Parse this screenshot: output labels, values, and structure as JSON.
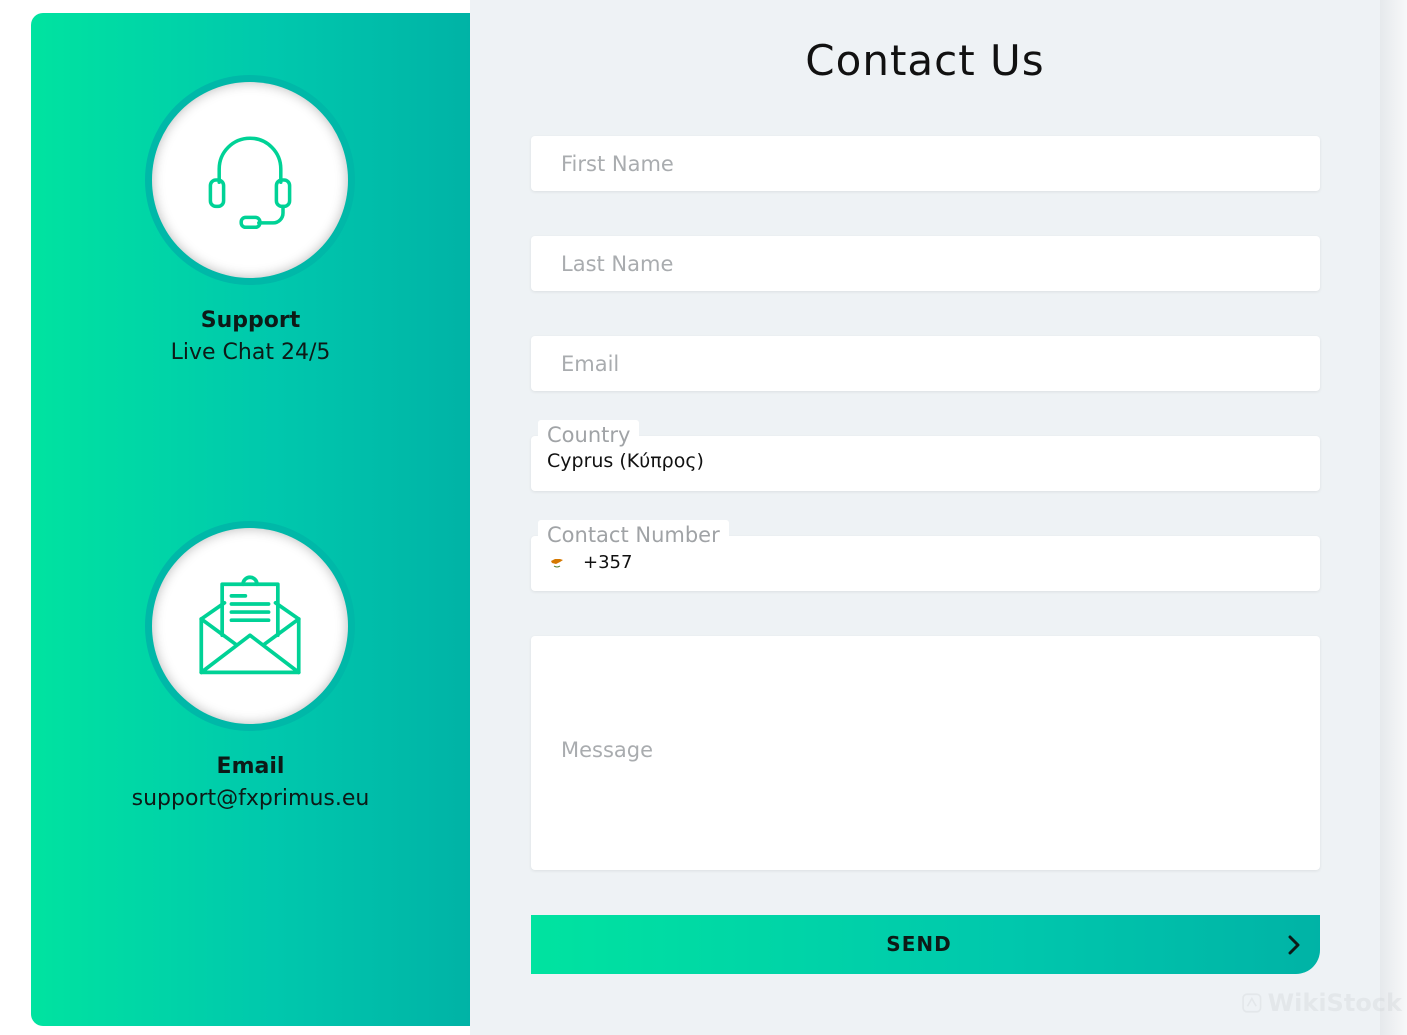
{
  "contact_info": {
    "support": {
      "title": "Support",
      "value": "Live Chat 24/5",
      "icon": "headset-icon"
    },
    "email": {
      "title": "Email",
      "value": "support@fxprimus.eu",
      "icon": "open-envelope-icon"
    }
  },
  "form": {
    "title": "Contact Us",
    "first_name": {
      "placeholder": "First Name",
      "value": ""
    },
    "last_name": {
      "placeholder": "Last Name",
      "value": ""
    },
    "email": {
      "placeholder": "Email",
      "value": ""
    },
    "country": {
      "label": "Country",
      "value": "Cyprus (Κύπρος)"
    },
    "contact_number": {
      "label": "Contact Number",
      "dial_code": "+357",
      "flag": "cyprus-flag-icon"
    },
    "message": {
      "placeholder": "Message",
      "value": ""
    },
    "send_label": "SEND"
  },
  "watermark": {
    "text": "WikiStock"
  },
  "colors": {
    "accent_start": "#00e3a0",
    "accent_end": "#00b3a6",
    "icon_stroke": "#00d296",
    "form_background": "#eef2f5"
  }
}
